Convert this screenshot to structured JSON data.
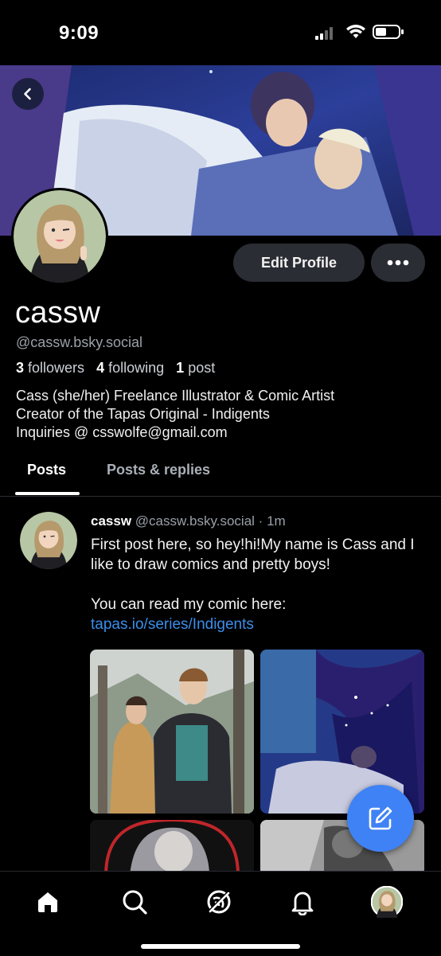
{
  "status_bar": {
    "time": "9:09"
  },
  "profile": {
    "display_name": "cassw",
    "handle": "@cassw.bsky.social",
    "followers_count": "3",
    "followers_label": "followers",
    "following_count": "4",
    "following_label": "following",
    "posts_count": "1",
    "posts_label": "post",
    "bio": "Cass (she/her) Freelance Illustrator & Comic Artist\nCreator of the Tapas Original - Indigents\nInquiries @ csswolfe@gmail.com",
    "edit_button": "Edit Profile"
  },
  "tabs": [
    {
      "label": "Posts",
      "active": true
    },
    {
      "label": "Posts & replies",
      "active": false
    }
  ],
  "post": {
    "author": "cassw",
    "handle": "@cassw.bsky.social",
    "separator": "·",
    "time": "1m",
    "text": "First post here, so hey!hi!My name is Cass and I like to draw comics and pretty boys!\n\nYou can read my comic here:",
    "link": "tapas.io/series/Indigents"
  },
  "colors": {
    "accent": "#3f82f5",
    "link": "#3b8eea",
    "button_bg": "#2a2d33"
  },
  "icons": {
    "back": "chevron-left-icon",
    "more": "ellipsis-icon",
    "compose": "compose-icon",
    "nav": [
      "home-icon",
      "search-icon",
      "feeds-icon",
      "notifications-icon",
      "profile-avatar"
    ]
  }
}
